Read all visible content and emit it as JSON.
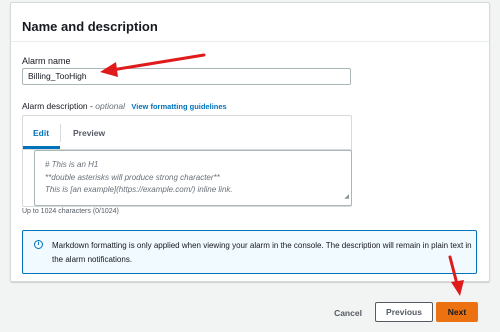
{
  "panel": {
    "title": "Name and description"
  },
  "alarm_name": {
    "label": "Alarm name",
    "value": "Billing_TooHigh"
  },
  "alarm_description": {
    "label": "Alarm description",
    "optional": "optional",
    "guidelines_link": "View formatting guidelines",
    "tabs": [
      "Edit",
      "Preview"
    ],
    "active_tab": "Edit",
    "placeholder_lines": [
      "# This is an H1",
      "**double asterisks will produce strong character**",
      "This is [an example](https://example.com/) inline link."
    ],
    "char_limit_text": "Up to 1024 characters (0/1024)"
  },
  "info": {
    "icon": "info-icon",
    "text": "Markdown formatting is only applied when viewing your alarm in the console. The description will remain in plain text in the alarm notifications."
  },
  "footer": {
    "cancel": "Cancel",
    "previous": "Previous",
    "next": "Next"
  },
  "colors": {
    "accent_blue": "#0073bb",
    "primary_button": "#ec7211",
    "annotation_arrow": "#e01b1b",
    "background": "#f2f3f3"
  }
}
